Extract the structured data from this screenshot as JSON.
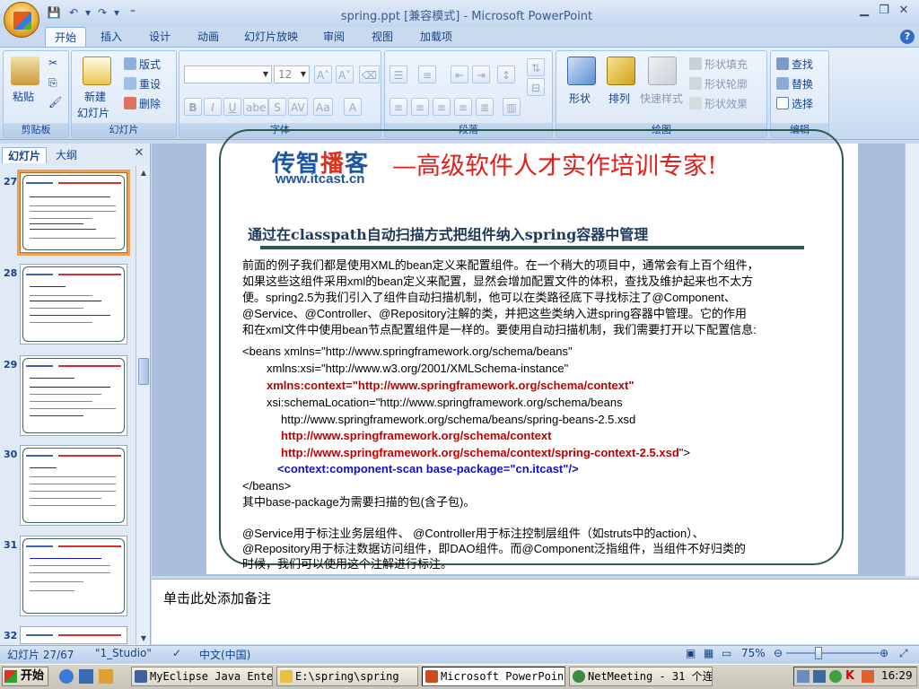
{
  "window": {
    "title": "spring.ppt [兼容模式] - Microsoft PowerPoint"
  },
  "tabs": [
    "开始",
    "插入",
    "设计",
    "动画",
    "幻灯片放映",
    "审阅",
    "视图",
    "加载项"
  ],
  "ribbon": {
    "clipboard": {
      "label": "剪贴板",
      "paste": "粘贴"
    },
    "slides": {
      "label": "幻灯片",
      "new_slide_1": "新建",
      "new_slide_2": "幻灯片",
      "layout": "版式",
      "reset": "重设",
      "delete": "删除"
    },
    "font": {
      "label": "字体",
      "size": "12"
    },
    "paragraph": {
      "label": "段落"
    },
    "drawing": {
      "label": "绘图",
      "shapes": "形状",
      "arrange": "排列",
      "quick_styles": "快速样式",
      "shape_fill": "形状填充",
      "shape_outline": "形状轮廓",
      "shape_effects": "形状效果"
    },
    "editing": {
      "label": "编辑",
      "find": "查找",
      "replace": "替换",
      "select": "选择"
    }
  },
  "panel": {
    "tab_slides": "幻灯片",
    "tab_outline": "大纲",
    "thumbs": [
      "27",
      "28",
      "29",
      "30",
      "31",
      "32"
    ]
  },
  "slide": {
    "logo_a": "传智",
    "logo_hl": "播",
    "logo_b": "客",
    "url": "www.itcast.cn",
    "slogan": "—高级软件人才实作培训专家!",
    "title": "通过在classpath自动扫描方式把组件纳入spring容器中管理",
    "para1": [
      "前面的例子我们都是使用XML的bean定义来配置组件。在一个稍大的项目中，通常会有上百个组件，",
      "如果这些这组件采用xml的bean定义来配置，显然会增加配置文件的体积，查找及维护起来也不太方",
      "便。spring2.5为我们引入了组件自动扫描机制，他可以在类路径底下寻找标注了@Component、",
      "@Service、@Controller、@Repository注解的类，并把这些类纳入进spring容器中管理。它的作用",
      "和在xml文件中使用bean节点配置组件是一样的。要使用自动扫描机制，我们需要打开以下配置信息:"
    ],
    "code1": "<beans xmlns=\"http://www.springframework.org/schema/beans\"",
    "code2": "xmlns:xsi=\"http://www.w3.org/2001/XMLSchema-instance\"",
    "code3": "xmlns:context=\"http://www.springframework.org/schema/context\"",
    "code4": "xsi:schemaLocation=\"http://www.springframework.org/schema/beans",
    "code5": "http://www.springframework.org/schema/beans/spring-beans-2.5.xsd",
    "code6": "http://www.springframework.org/schema/context",
    "code7": "http://www.springframework.org/schema/context/spring-context-2.5.xsd",
    "code7_tail": "\">",
    "code8": "<context:component-scan base-package=\"cn.itcast\"/>",
    "code9": "</beans>",
    "note": "其中base-package为需要扫描的包(含子包)。",
    "para2": [
      "@Service用于标注业务层组件、 @Controller用于标注控制层组件（如struts中的action）、",
      "@Repository用于标注数据访问组件，即DAO组件。而@Component泛指组件，当组件不好归类的",
      "时候，我们可以使用这个注解进行标注。"
    ]
  },
  "notes": {
    "placeholder": "单击此处添加备注"
  },
  "status": {
    "slide_pos": "幻灯片 27/67",
    "theme": "\"1_Studio\"",
    "language": "中文(中国)",
    "zoom": "75%"
  },
  "taskbar": {
    "start": "开始",
    "tasks": [
      "MyEclipse Java Ente...",
      "E:\\spring\\spring",
      "Microsoft PowerPoin...",
      "NetMeeting - 31 个连接"
    ],
    "clock": "16:29"
  }
}
